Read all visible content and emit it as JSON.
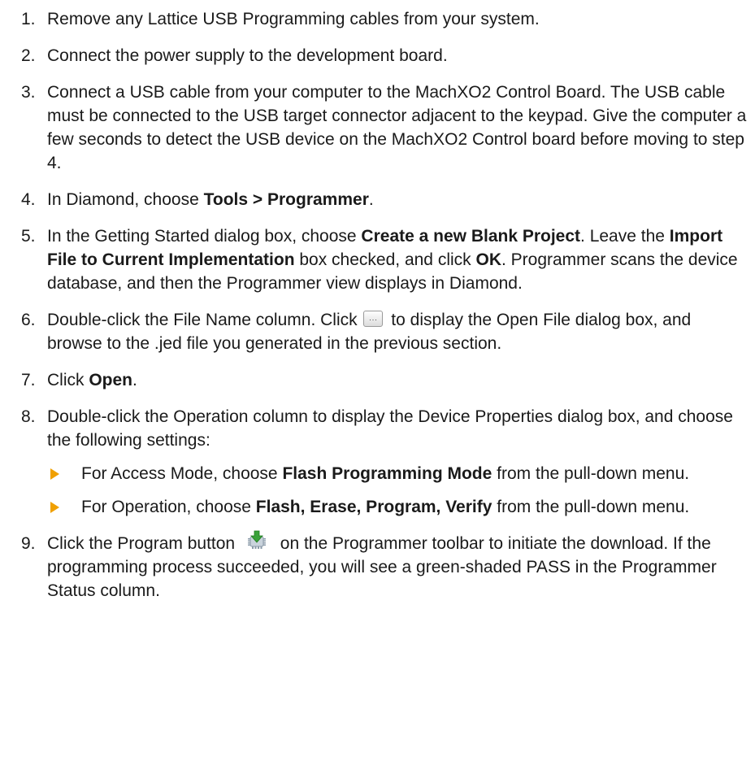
{
  "steps": [
    {
      "num": "1.",
      "parts": [
        {
          "t": "Remove any Lattice USB Programming cables from your system."
        }
      ]
    },
    {
      "num": "2.",
      "parts": [
        {
          "t": "Connect the power supply to the development board."
        }
      ]
    },
    {
      "num": "3.",
      "parts": [
        {
          "t": "Connect a USB cable from your computer to the MachXO2 Control Board. The USB cable must be connected to the USB target connector adjacent to the keypad. Give the computer a few seconds to detect the USB device on the MachXO2 Control board before moving to step 4."
        }
      ]
    },
    {
      "num": "4.",
      "parts": [
        {
          "t": "In Diamond, choose "
        },
        {
          "t": "Tools > Programmer",
          "b": true
        },
        {
          "t": "."
        }
      ]
    },
    {
      "num": "5.",
      "parts": [
        {
          "t": "In the Getting Started dialog box, choose "
        },
        {
          "t": "Create a new Blank Project",
          "b": true
        },
        {
          "t": ". Leave the "
        },
        {
          "t": "Import File to Current Implementation",
          "b": true
        },
        {
          "t": " box checked, and click "
        },
        {
          "t": "OK",
          "b": true
        },
        {
          "t": ". Programmer scans the device database, and then the Programmer view displays in Diamond."
        }
      ]
    },
    {
      "num": "6.",
      "parts": [
        {
          "t": "Double-click the File Name column. Click "
        },
        {
          "icon": "browse-button-icon"
        },
        {
          "t": " to display the Open File dialog box, and browse to the .jed file you generated in the previous section."
        }
      ]
    },
    {
      "num": "7.",
      "parts": [
        {
          "t": "Click "
        },
        {
          "t": "Open",
          "b": true
        },
        {
          "t": "."
        }
      ]
    },
    {
      "num": "8.",
      "parts": [
        {
          "t": "Double-click the Operation column to display the Device Properties dialog box, and choose the following settings:"
        }
      ],
      "subs": [
        [
          {
            "t": "For Access Mode, choose "
          },
          {
            "t": "Flash Programming Mode",
            "b": true
          },
          {
            "t": " from the pull-down menu."
          }
        ],
        [
          {
            "t": "For Operation, choose "
          },
          {
            "t": "Flash, Erase, Program, Verify",
            "b": true
          },
          {
            "t": " from the pull-down menu."
          }
        ]
      ]
    },
    {
      "num": "9.",
      "parts": [
        {
          "t": "Click the Program button "
        },
        {
          "icon": "program-download-icon"
        },
        {
          "t": " on the Programmer toolbar to initiate the download. If the programming process succeeded, you will see a green-shaded PASS in the Programmer Status column."
        }
      ]
    }
  ],
  "colors": {
    "bullet": "#f0a000",
    "text": "#1a1a1a",
    "icon_green": "#3aa23a",
    "icon_gray": "#8a9aa8"
  }
}
